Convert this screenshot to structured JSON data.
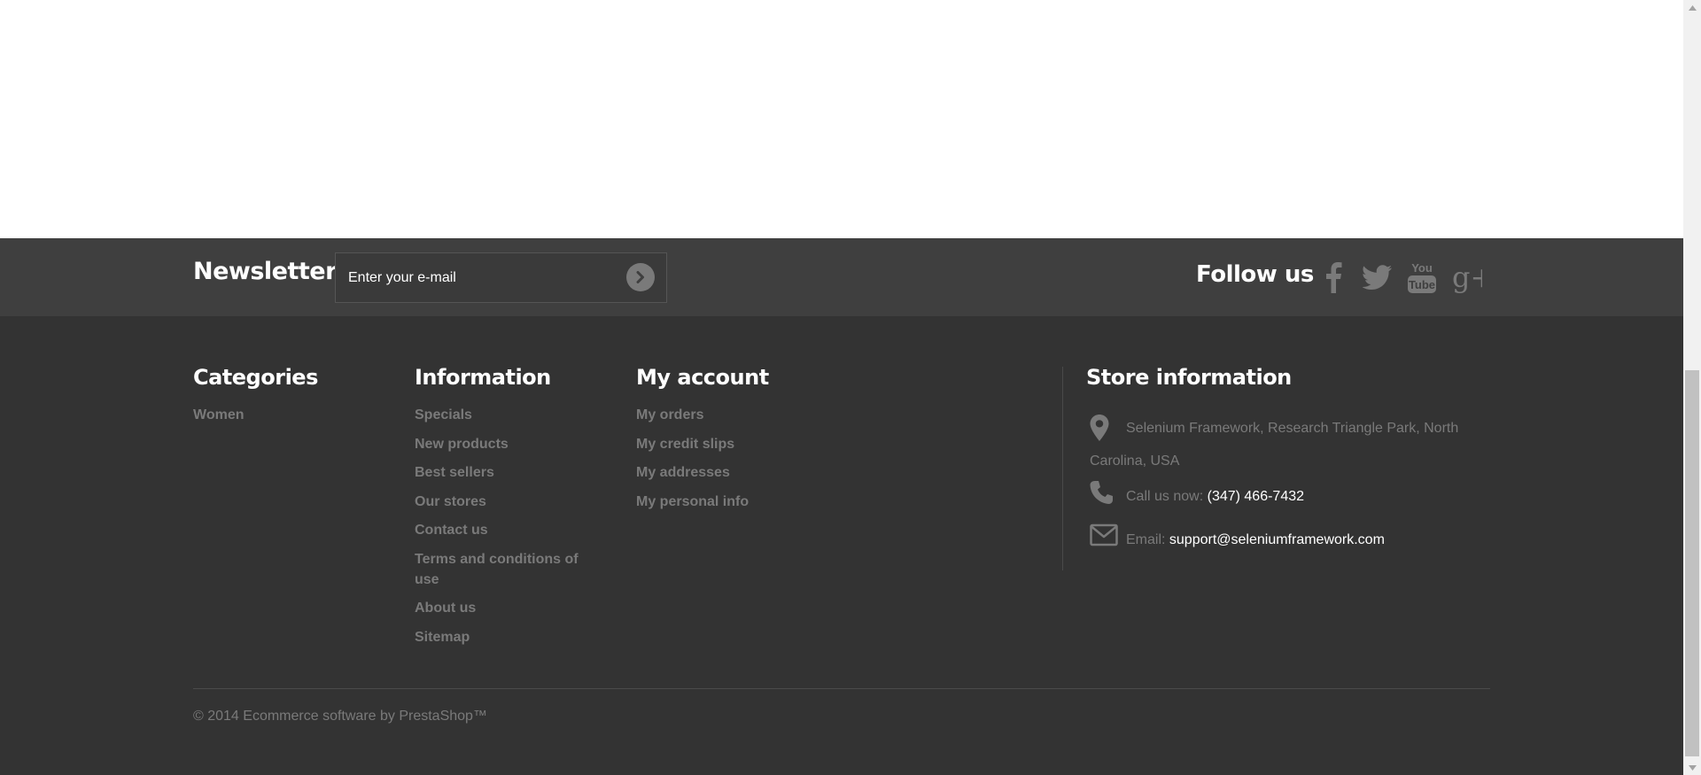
{
  "newsletter": {
    "title": "Newsletter",
    "placeholder": "Enter your e-mail",
    "submit_icon": "chevron-right-icon"
  },
  "follow": {
    "title": "Follow us",
    "icons": [
      "facebook-icon",
      "twitter-icon",
      "youtube-icon",
      "google-plus-icon"
    ],
    "youtube_text_top": "You",
    "youtube_text_bottom": "Tube",
    "gplus_text": "g+"
  },
  "categories": {
    "title": "Categories",
    "items": [
      "Women"
    ]
  },
  "information": {
    "title": "Information",
    "items": [
      "Specials",
      "New products",
      "Best sellers",
      "Our stores",
      "Contact us",
      "Terms and conditions of use",
      "About us",
      "Sitemap"
    ]
  },
  "account": {
    "title": "My account",
    "items": [
      "My orders",
      "My credit slips",
      "My addresses",
      "My personal info"
    ]
  },
  "store": {
    "title": "Store information",
    "address": "Selenium Framework, Research Triangle Park, North Carolina, USA",
    "phone_label": "Call us now:",
    "phone_value": "(347) 466-7432",
    "email_label": "Email:",
    "email_value": "support@seleniumframework.com"
  },
  "copyright": "© 2014 Ecommerce software by PrestaShop™",
  "colors": {
    "newsletter_bg": "#3f3f3f",
    "footer_bg": "#333333",
    "link_gray": "#7a7a7a",
    "heading_white": "#ffffff"
  }
}
